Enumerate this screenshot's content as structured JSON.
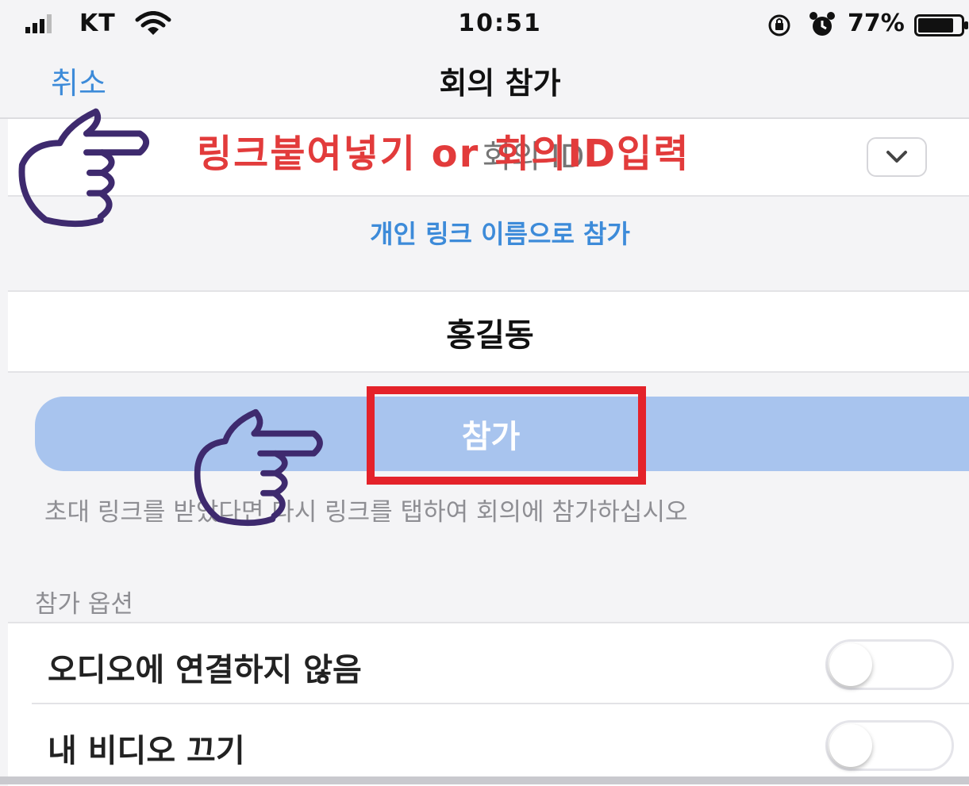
{
  "status_bar": {
    "carrier": "KT",
    "time": "10:51",
    "battery": "77%",
    "battery_level": 0.77,
    "icons": [
      "signal-icon",
      "wifi-icon",
      "orientation-lock-icon",
      "alarm-icon",
      "battery-icon"
    ]
  },
  "nav": {
    "cancel_label": "취소",
    "title": "회의 참가"
  },
  "meeting_id": {
    "placeholder": "회의 ID",
    "annotation": "링크붙여넣기 or 회의ID입력",
    "dropdown_icon": "chevron-down-icon"
  },
  "personal_link_label": "개인 링크 이름으로 참가",
  "name_value": "홍길동",
  "join_label": "참가",
  "hint_text": "초대 링크를 받았다면 다시 링크를 탭하여 회의에 참가하십시오",
  "options": {
    "section_label": "참가 옵션",
    "items": [
      {
        "label": "오디오에 연결하지 않음",
        "on": false
      },
      {
        "label": "내 비디오 끄기",
        "on": false
      }
    ]
  },
  "colors": {
    "accent": "#3d8bd9",
    "join_button": "#a8c4ee",
    "annotation_red": "#e4222a",
    "hand_outline": "#3e2a6e"
  }
}
